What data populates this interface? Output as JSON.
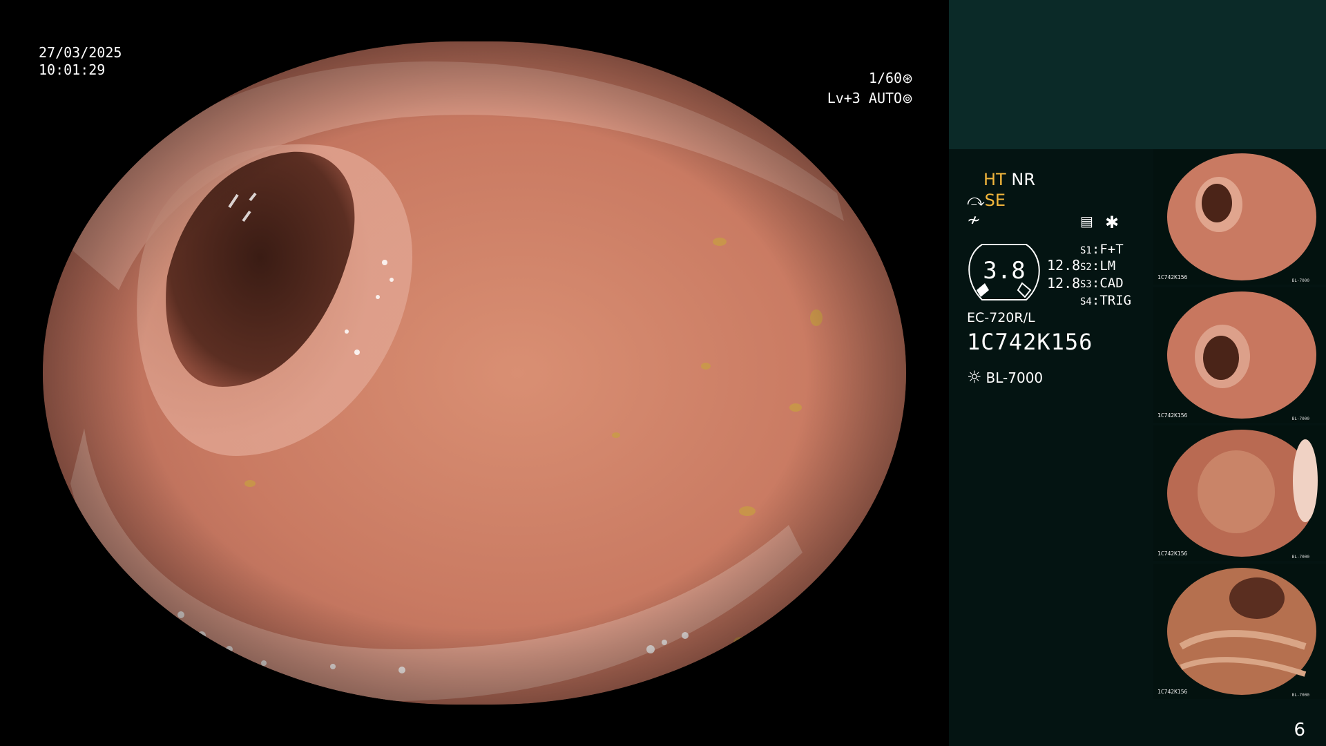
{
  "overlay": {
    "date": "27/03/2025",
    "time": "10:01:29",
    "shutter": "1/60",
    "shutter_icon": "aperture-icon",
    "level": "Lv+3",
    "mode": "AUTO",
    "mode_icon": "auto-iris-icon"
  },
  "side_panel": {
    "ht": "HT",
    "nr": "NR",
    "se": "SE",
    "neq_symbol": "≁",
    "gauge_value": "3.8",
    "gauge_line1": "12.8",
    "gauge_line2": "12.8",
    "switches": [
      {
        "key": "S1",
        "value": "F+T"
      },
      {
        "key": "S2",
        "value": "LM"
      },
      {
        "key": "S3",
        "value": "CAD"
      },
      {
        "key": "S4",
        "value": "TRIG"
      }
    ],
    "scope_model": "EC-720R/L",
    "serial": "1C742K156",
    "light_source": "BL-7000",
    "colors": {
      "accent_yellow": "#f2b63c",
      "panel_bg": "#041412",
      "panel_top_bg": "#0b2a28"
    }
  },
  "thumbnails": [
    {
      "id": 1,
      "serial": "1C742K156",
      "light": "BL-7000"
    },
    {
      "id": 2,
      "serial": "1C742K156",
      "light": "BL-7000"
    },
    {
      "id": 3,
      "serial": "1C742K156",
      "light": "BL-7000"
    },
    {
      "id": 4,
      "serial": "1C742K156",
      "light": "BL-7000"
    }
  ],
  "page_number": "6"
}
